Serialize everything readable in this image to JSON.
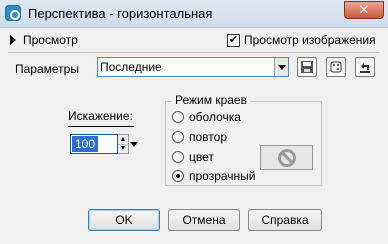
{
  "window": {
    "title": "Перспектива - горизонтальная"
  },
  "preview": {
    "label": "Просмотр",
    "show_image_label": "Просмотр изображения",
    "show_image_checked": "✔"
  },
  "params": {
    "label": "Параметры",
    "preset_value": "Последние"
  },
  "distortion": {
    "label": "Искажение:",
    "value": "100"
  },
  "edge_mode": {
    "title": "Режим краев",
    "options": [
      {
        "label": "оболочка",
        "selected": false
      },
      {
        "label": "повтор",
        "selected": false
      },
      {
        "label": "цвет",
        "selected": false
      },
      {
        "label": "прозрачный",
        "selected": true
      }
    ]
  },
  "buttons": {
    "ok": "OK",
    "cancel": "Отмена",
    "help": "Справка"
  }
}
